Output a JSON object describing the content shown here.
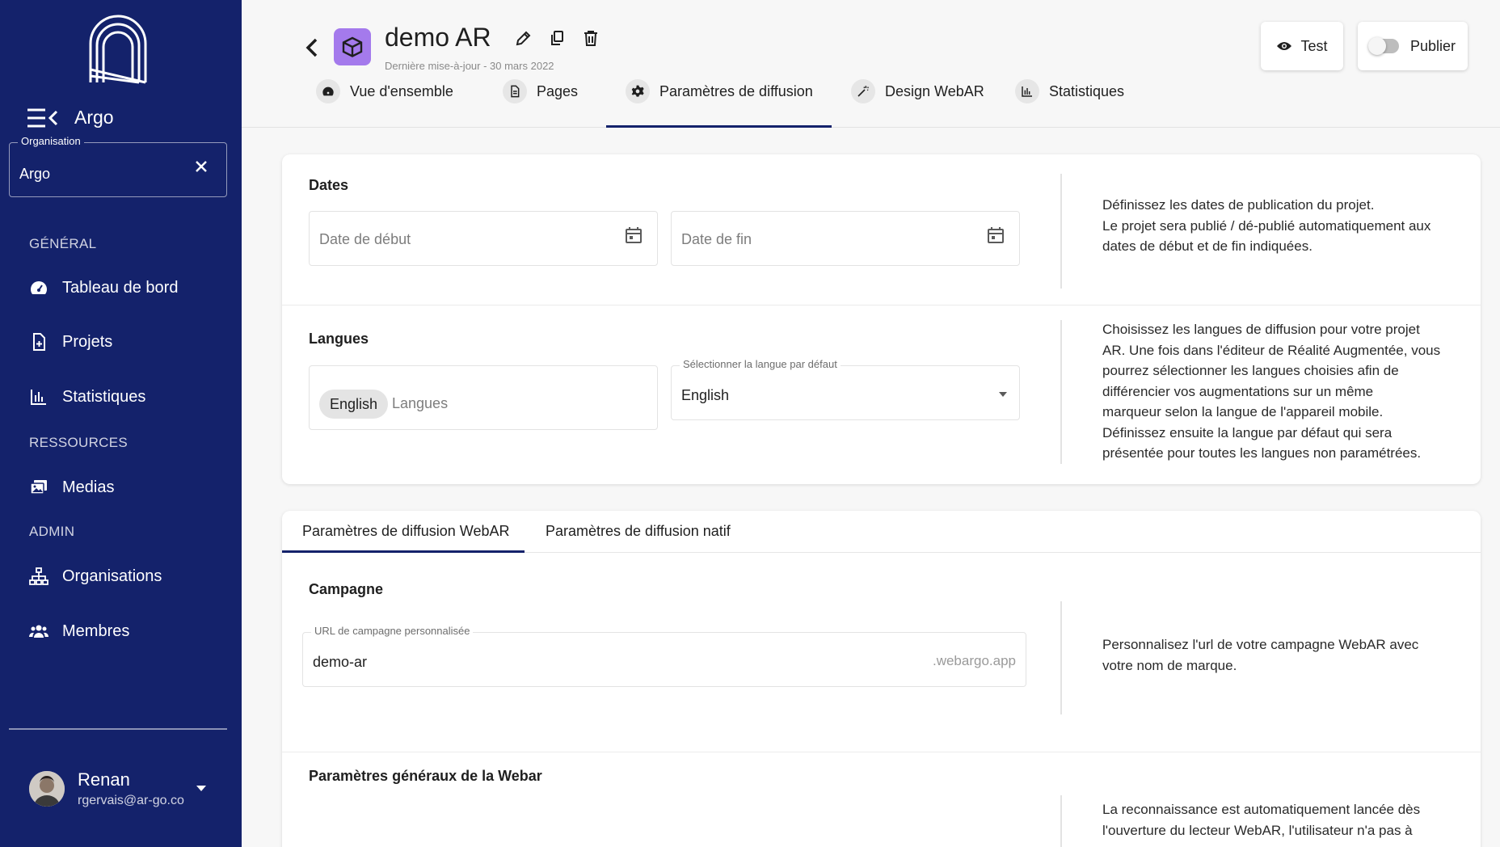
{
  "sidebar": {
    "brand": "Argo",
    "org_label": "Organisation",
    "org_value": "Argo",
    "sections": {
      "general": "GÉNÉRAL",
      "resources": "RESSOURCES",
      "admin": "ADMIN"
    },
    "items": [
      {
        "label": "Tableau de bord",
        "icon": "dashboard-icon"
      },
      {
        "label": "Projets",
        "icon": "file-icon"
      },
      {
        "label": "Statistiques",
        "icon": "bar-chart-icon"
      },
      {
        "label": "Medias",
        "icon": "media-icon"
      },
      {
        "label": "Organisations",
        "icon": "sitemap-icon"
      },
      {
        "label": "Membres",
        "icon": "users-icon"
      }
    ],
    "user": {
      "name": "Renan",
      "email": "rgervais@ar-go.co"
    }
  },
  "header": {
    "title": "demo AR",
    "subtitle": "Dernière mise-à-jour - 30 mars 2022",
    "test_label": "Test",
    "publish_label": "Publier",
    "tabs": [
      {
        "label": "Vue d'ensemble",
        "icon": "dashboard-icon"
      },
      {
        "label": "Pages",
        "icon": "file-icon"
      },
      {
        "label": "Paramètres de diffusion",
        "icon": "gear-icon",
        "active": true
      },
      {
        "label": "Design WebAR",
        "icon": "magic-wand-icon"
      },
      {
        "label": "Statistiques",
        "icon": "bar-chart-icon"
      }
    ]
  },
  "dates": {
    "title": "Dates",
    "start_placeholder": "Date de début",
    "end_placeholder": "Date de fin",
    "desc": [
      "Définissez les dates de publication du projet.",
      "Le projet sera publié / dé-publié automatiquement aux",
      "dates de début et de fin indiquées."
    ]
  },
  "langues": {
    "title": "Langues",
    "chip": "English",
    "placeholder": "Langues",
    "default_label": "Sélectionner la langue par défaut",
    "default_value": "English",
    "desc": [
      "Choisissez les langues de diffusion pour votre projet",
      "AR. Une fois dans l'éditeur de Réalité Augmentée, vous",
      "pourrez sélectionner les langues choisies afin de",
      "différencier vos augmentations sur un même",
      "marqueur selon la langue de l'appareil mobile.",
      "Définissez ensuite la langue par défaut qui sera",
      "présentée pour toutes les langues non paramétrées."
    ]
  },
  "diffusion": {
    "tabs": [
      {
        "label": "Paramètres de diffusion WebAR",
        "active": true
      },
      {
        "label": "Paramètres de diffusion natif"
      }
    ],
    "campagne_title": "Campagne",
    "url_label": "URL de campagne personnalisée",
    "url_value": "demo-ar",
    "url_suffix": ".webargo.app",
    "campagne_desc": [
      "Personnalisez l'url de votre campagne WebAR avec",
      "votre nom de marque."
    ],
    "general_title": "Paramètres généraux de la Webar",
    "general_desc": [
      "La reconnaissance est automatiquement lancée dès",
      "l'ouverture du lecteur WebAR, l'utilisateur n'a pas à"
    ]
  },
  "colors": {
    "sidebar": "#14226b",
    "accent": "#14226b",
    "project_icon": "#a47aec"
  }
}
